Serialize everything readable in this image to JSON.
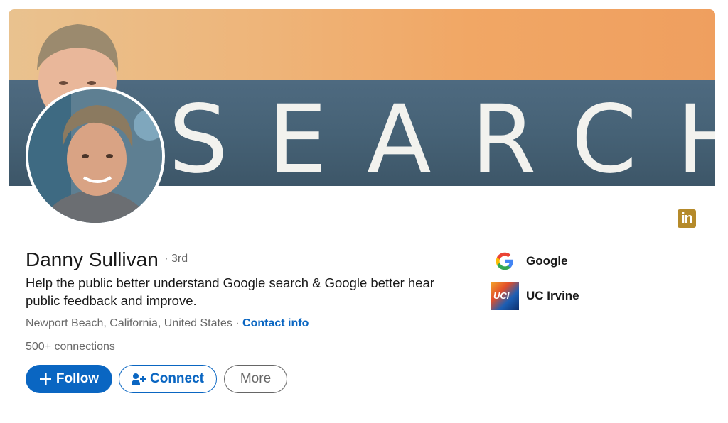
{
  "profile": {
    "name": "Danny Sullivan",
    "degree": "· 3rd",
    "headline": "Help the public better understand Google search & Google better hear public feedback and improve.",
    "location": "Newport Beach, California, United States",
    "separator": "·",
    "contact_link": "Contact info",
    "connections": "500+ connections"
  },
  "banner": {
    "sign_text": "SEARCH"
  },
  "badge": {
    "text": "in"
  },
  "actions": {
    "follow_label": "Follow",
    "connect_label": "Connect",
    "more_label": "More"
  },
  "orgs": [
    {
      "name": "Google",
      "icon": "google-logo"
    },
    {
      "name": "UC Irvine",
      "icon": "uc-irvine-logo",
      "logo_text": "UCI"
    }
  ],
  "colors": {
    "accent": "#0a66c2",
    "badge": "#b58a2a"
  }
}
